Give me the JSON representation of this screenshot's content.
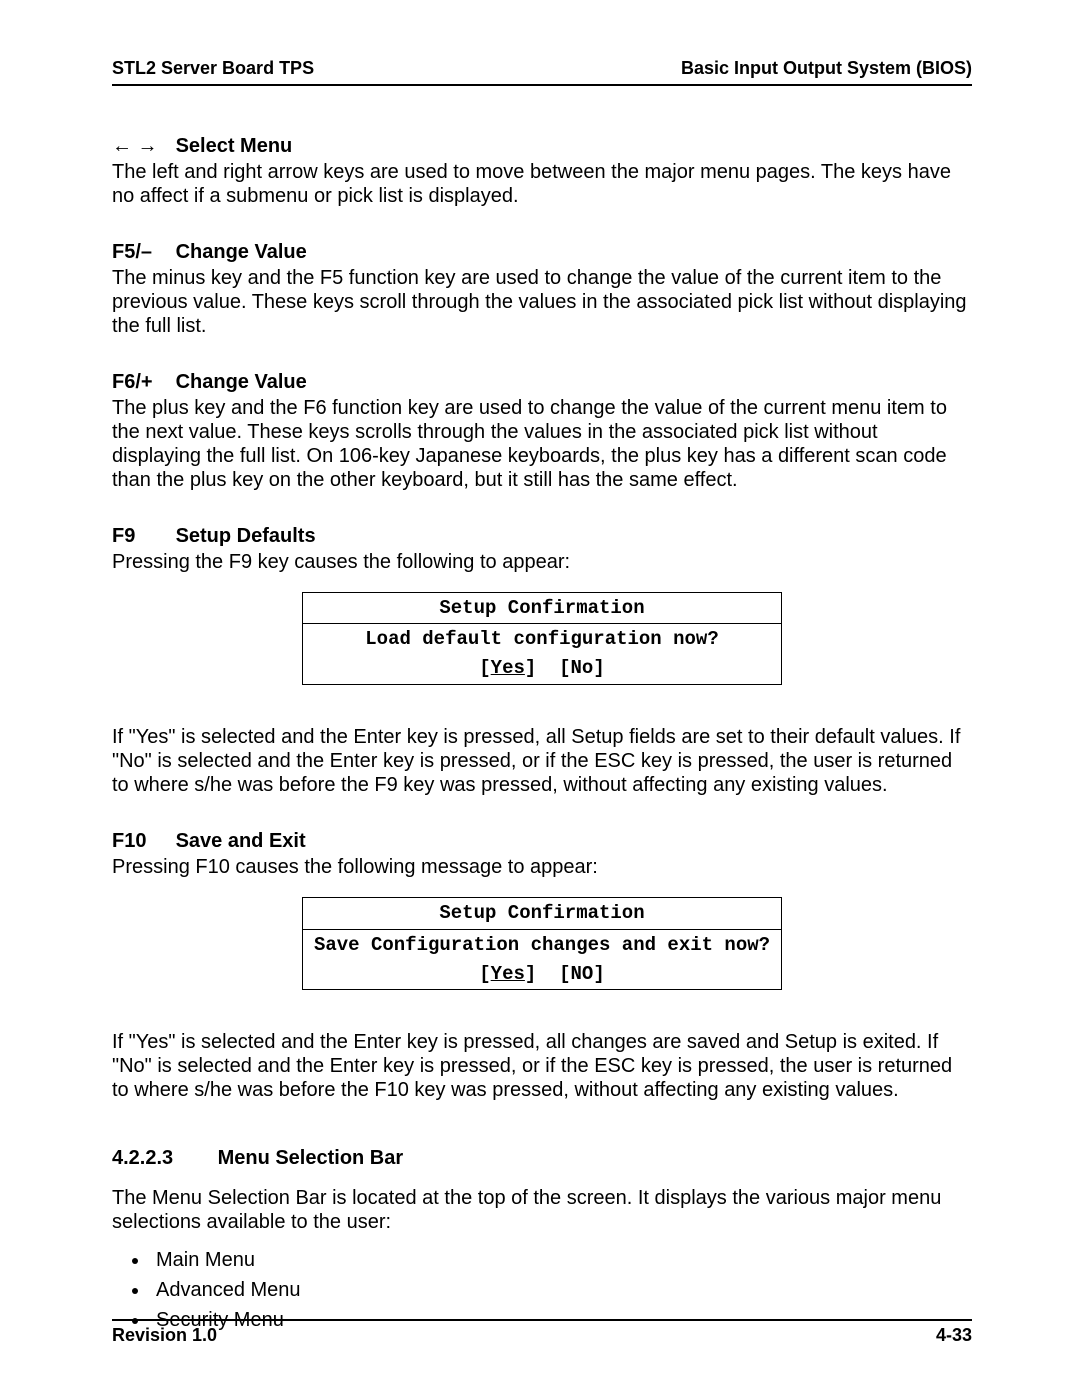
{
  "header": {
    "left": "STL2 Server Board TPS",
    "right": "Basic Input Output System (BIOS)"
  },
  "footer": {
    "left": "Revision 1.0",
    "right": "4-33"
  },
  "sections": {
    "selectMenu": {
      "arrows": "←  →",
      "title": "Select Menu",
      "body": "The left and right arrow keys are used to move between the major menu pages. The keys have no affect if a submenu or pick list is displayed."
    },
    "f5": {
      "key": "F5/–",
      "title": "Change Value",
      "body": "The minus key and the F5 function key are used to change the value of the current item to the previous value. These keys scroll through the values in the associated pick list without displaying the full list."
    },
    "f6": {
      "key": "F6/+",
      "title": "Change Value",
      "body": "The plus key and the F6 function key are used to change the value of the current menu item to the next value. These keys scrolls through the values in the associated pick list without displaying the full list. On 106-key Japanese keyboards, the plus key has a different scan code than the plus key on the other keyboard, but it still has the same effect."
    },
    "f9": {
      "key": "F9",
      "title": "Setup Defaults",
      "lead": "Pressing the F9 key causes the following to appear:",
      "dialog": {
        "title": "Setup Confirmation",
        "question": "Load default configuration now?",
        "yes": "Yes",
        "no": "No"
      },
      "after": "If \"Yes\" is selected and the Enter key is pressed, all Setup fields are set to their default values. If \"No\" is selected and the Enter key is pressed, or if the ESC key is pressed, the user is returned to where s/he was before the F9 key was pressed, without affecting any existing values."
    },
    "f10": {
      "key": "F10",
      "title": "Save and Exit",
      "lead": "Pressing F10 causes the following message to appear:",
      "dialog": {
        "title": "Setup Confirmation",
        "question": "Save Configuration changes and exit now?",
        "yes": "Yes",
        "no": "NO"
      },
      "after": "If \"Yes\" is selected and the Enter key is pressed, all changes are saved and Setup is exited. If \"No\" is selected and the Enter key is pressed, or if the ESC key is pressed, the user is returned to where s/he was before the F10 key was pressed, without affecting any existing values."
    },
    "menuBar": {
      "num": "4.2.2.3",
      "title": "Menu Selection Bar",
      "body": "The Menu Selection Bar is located at the top of the screen. It displays the various major menu selections available to the user:",
      "items": [
        "Main Menu",
        "Advanced Menu",
        "Security Menu"
      ]
    }
  }
}
